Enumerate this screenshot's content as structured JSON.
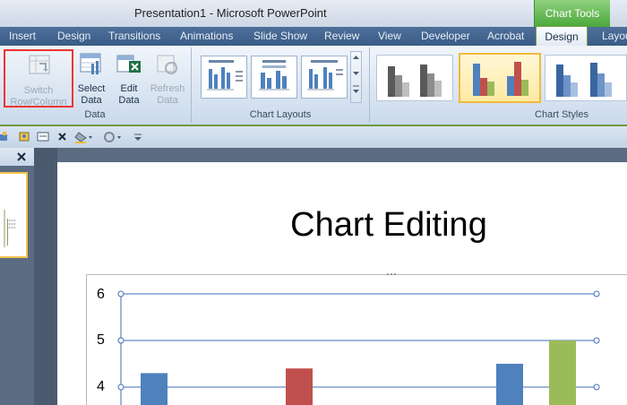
{
  "window": {
    "title": "Presentation1 - Microsoft PowerPoint",
    "context_tab": "Chart Tools"
  },
  "tabs": [
    "Insert",
    "Design",
    "Transitions",
    "Animations",
    "Slide Show",
    "Review",
    "View",
    "Developer",
    "Acrobat"
  ],
  "active_tab": "Design",
  "cut_tab": "Layou",
  "ribbon": {
    "data_group": {
      "label": "Data",
      "switch": "Switch Row/Column",
      "switch_l1": "Switch",
      "switch_l2": "Row/Column",
      "select_l1": "Select",
      "select_l2": "Data",
      "edit_l1": "Edit",
      "edit_l2": "Data",
      "refresh_l1": "Refresh",
      "refresh_l2": "Data"
    },
    "layouts_label": "Chart Layouts",
    "styles_label": "Chart Styles"
  },
  "slide": {
    "title": "Chart Editing"
  },
  "chart_data": {
    "type": "bar",
    "y_ticks": [
      "6",
      "5",
      "4"
    ],
    "visible_bars": [
      {
        "value": 4.3,
        "color": "#4f81bd"
      },
      {
        "value": 4.4,
        "color": "#c0504d"
      },
      {
        "value": 4.5,
        "color": "#4f81bd"
      },
      {
        "value": 5.0,
        "color": "#9bbb59"
      }
    ],
    "colors": {
      "series1": "#4f81bd",
      "series2": "#c0504d",
      "series3": "#9bbb59"
    }
  }
}
